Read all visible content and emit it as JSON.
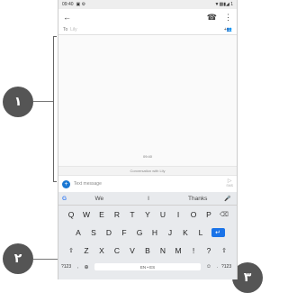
{
  "status": {
    "time": "09:40",
    "left_icons": "▣ ⚙",
    "right_icons": "▼▩▮◢ 1"
  },
  "appbar": {
    "back_icon": "←",
    "call_icon": "☎",
    "menu_icon": "⋮"
  },
  "to": {
    "label": "To",
    "value": "Lily",
    "add_icon": "+👥"
  },
  "conversation": {
    "timestamp": "09:40",
    "with_label": "Conversation with Lily"
  },
  "compose": {
    "plus_icon": "+",
    "placeholder": "Text message",
    "send_icon": "▷",
    "send_label": "SMS"
  },
  "suggestions": {
    "g": "G",
    "words": [
      "We",
      "I",
      "Thanks"
    ],
    "mic_icon": "🎤"
  },
  "keyboard": {
    "row1": [
      "Q",
      "W",
      "E",
      "R",
      "T",
      "Y",
      "U",
      "I",
      "O",
      "P"
    ],
    "row2": [
      "A",
      "S",
      "D",
      "F",
      "G",
      "H",
      "J",
      "K",
      "L"
    ],
    "row3": [
      "Z",
      "X",
      "C",
      "V",
      "B",
      "N",
      "M",
      "!",
      "?"
    ],
    "backspace_icon": "⌫",
    "shift_icon": "⇧",
    "enter_icon": "↵",
    "numbers_label": "?123",
    "comma": ",",
    "globe_icon": "⊕",
    "space_label": "EN • ES",
    "emoji_icon": "☺",
    "period": "."
  },
  "callouts": {
    "c1": "١",
    "c2": "٢",
    "c3": "٣"
  }
}
